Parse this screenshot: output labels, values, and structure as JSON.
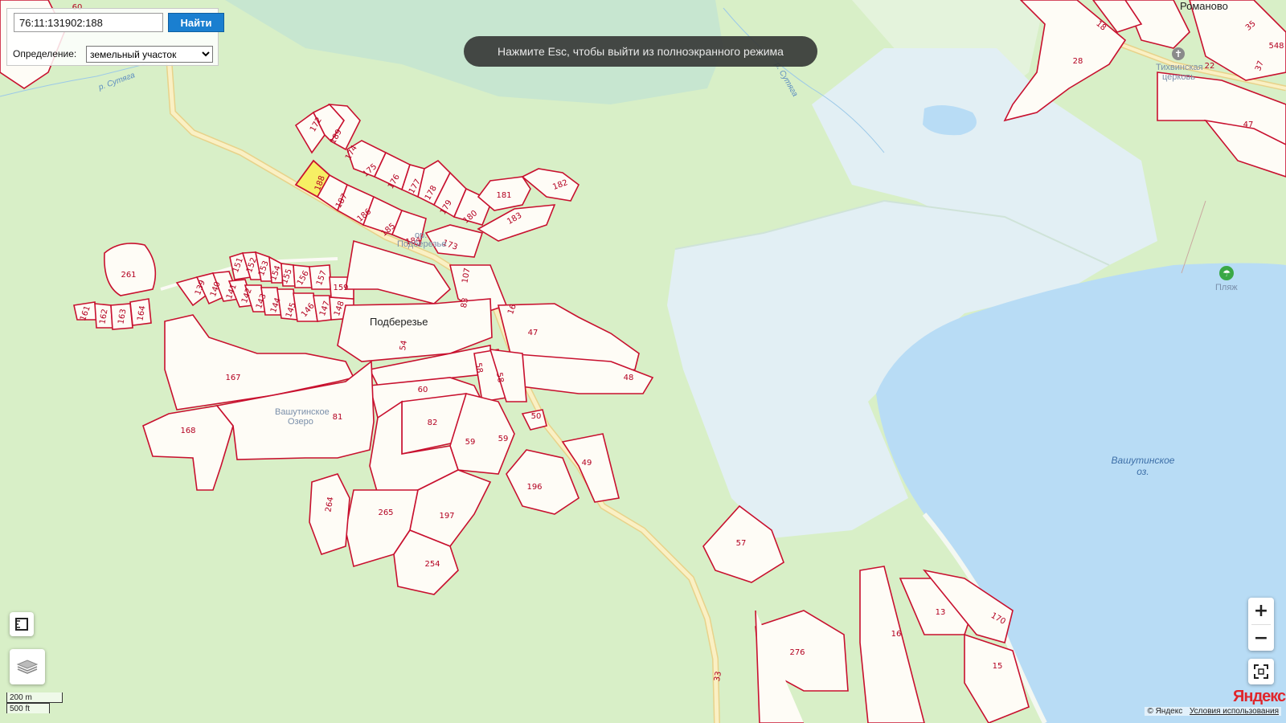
{
  "search": {
    "value": "76:11:131902:188",
    "button_label": "Найти",
    "definition_label": "Определение:",
    "definition_selected": "земельный участок"
  },
  "toast": {
    "text": "Нажмите Esc, чтобы выйти из полноэкранного режима"
  },
  "places": {
    "village_name": "Подберезье",
    "village_gray": "Подберезье",
    "village_prefix": "ор.",
    "romanovo": "Романово",
    "church_line1": "Тихвинская",
    "church_line2": "церковь",
    "beach": "Пляж",
    "lake_line1": "Вашутинское",
    "lake_line2": "оз.",
    "small_lake_line1": "Вашутинское",
    "small_lake_line2": "Озеро",
    "river1": "р. Сутяга",
    "river2": "р. Сутяга"
  },
  "parcels": {
    "p188": "188",
    "p172": "172",
    "p189": "189",
    "p174": "174",
    "p175": "175",
    "p176": "176",
    "p177": "177",
    "p178": "178",
    "p179": "179",
    "p180": "180",
    "p181": "181",
    "p182": "182",
    "p183": "183",
    "p187": "187",
    "p186": "186",
    "p185": "185",
    "p184": "184",
    "p173": "173",
    "p261": "261",
    "p151": "151",
    "p152": "152",
    "p153": "153",
    "p154": "154",
    "p155": "155",
    "p156": "156",
    "p157": "157",
    "p159": "159",
    "p139": "139",
    "p140": "140",
    "p141": "141",
    "p142": "142",
    "p143": "143",
    "p144": "144",
    "p145": "145",
    "p146": "146",
    "p147": "147",
    "p148": "148",
    "p161": "161",
    "p162": "162",
    "p163": "163",
    "p164": "164",
    "p167": "167",
    "p168": "168",
    "p81": "81",
    "p60": "60",
    "p82": "82",
    "p59a": "59",
    "p59b": "59",
    "p58a": "58",
    "p58b": "58",
    "p47": "47",
    "p48": "48",
    "p50": "50",
    "p49": "49",
    "p196": "196",
    "p197": "197",
    "p265": "265",
    "p264": "264",
    "p254": "254",
    "p57": "57",
    "p276": "276",
    "p16": "16",
    "p13": "13",
    "p170": "170",
    "p15": "15",
    "p33": "33",
    "p107": "107",
    "p83": "83",
    "p54": "54",
    "p28": "28",
    "p35": "35",
    "p548": "548",
    "p37": "37",
    "p22": "22",
    "p47b": "47",
    "p18": "18",
    "p60top": "60",
    "p16b": "16"
  },
  "controls": {
    "zoom_in": "+",
    "zoom_out": "−",
    "scale_metric": "200 m",
    "scale_imperial": "500 ft",
    "copyright": "© Яндекс",
    "terms": "Условия использования",
    "logo": "Яндекс"
  },
  "colors": {
    "parcel_stroke": "#c8102e",
    "parcel_fill": "#fefcf6",
    "selected_fill": "#f6ef64",
    "forest": "#d8efc7",
    "water": "#b8dcf5",
    "wetland": "#e2eff4",
    "road": "#f6e6a6",
    "button": "#1a7fd0"
  }
}
